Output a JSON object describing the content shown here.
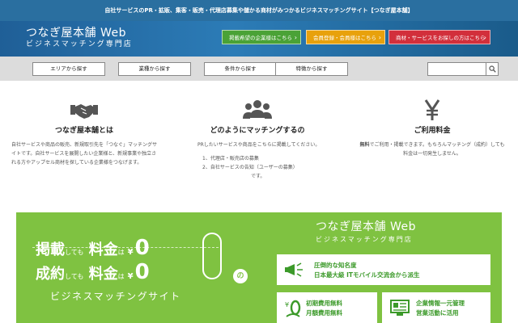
{
  "topbar": {
    "text": "自社サービスのPR・拡販、集客・販売・代理店募集や儲かる商材がみつかるビジネスマッチングサイト【つなぎ屋本舗】"
  },
  "header": {
    "logo_title": "つなぎ屋本舗 Web",
    "logo_sub": "ビジネスマッチング専門店",
    "buttons": [
      {
        "label": "掲載希望の企業様はこちら",
        "color": "#4aa236"
      },
      {
        "label": "会員登録・会員様はこちら",
        "color": "#e8a10c"
      },
      {
        "label": "商材・サービスをお探しの方はこちら",
        "color": "#d22f3b"
      }
    ],
    "arrow": "›"
  },
  "nav": {
    "items": [
      {
        "label": "エリアから探す"
      },
      {
        "label": "業種から探す"
      },
      {
        "label": "条件から探す"
      },
      {
        "label": "特徴から探す"
      }
    ],
    "search": {
      "value": "",
      "placeholder": ""
    }
  },
  "features": [
    {
      "icon": "handshake-icon",
      "title": "つなぎ屋本舗とは",
      "text": "自社サービスや商品の販売、新規取引先を「つなぐ」マッチングサイトです。自社サービスを展開したい企業様と、新規事業や独立される方やアップセル商材を探している企業様をつなげます。"
    },
    {
      "icon": "people-icon",
      "title": "どのようにマッチングするの",
      "text": "PRしたいサービスや商品をこちらに掲載してください。",
      "list": [
        "1、代理店・販売店の募集",
        "2、自社サービスの告知（ユーザーの募集）"
      ],
      "list_suffix": "です。"
    },
    {
      "icon": "yen-icon",
      "title": "ご利用料金",
      "text_strong": "無料",
      "text": "でご利用・掲載できます。もちろんマッチング（成約）しても料金は一切発生しません。"
    }
  ],
  "banner": {
    "line1": {
      "word": "掲載",
      "small": "しても",
      "fee": "料金",
      "wa": "は",
      "yen": "¥",
      "zero": "0"
    },
    "line2": {
      "word": "成約",
      "small": "しても",
      "fee": "料金",
      "wa": "は",
      "yen": "¥",
      "zero": "0"
    },
    "no": "の",
    "sub": "ビジネスマッチングサイト",
    "logo_title": "つなぎ屋本舗 Web",
    "logo_sub": "ビジネスマッチング専門店",
    "cards": [
      {
        "icon": "megaphone-icon",
        "lines": [
          "圧倒的な知名度",
          "日本最大級 ITモバイル交流会から派生"
        ]
      },
      {
        "icon": "zero-yen-icon",
        "lines": [
          "初期費用無料",
          "月額費用無料"
        ]
      },
      {
        "icon": "monitor-icon",
        "lines": [
          "企業情報一元管理",
          "営業活動に活用"
        ]
      }
    ]
  }
}
